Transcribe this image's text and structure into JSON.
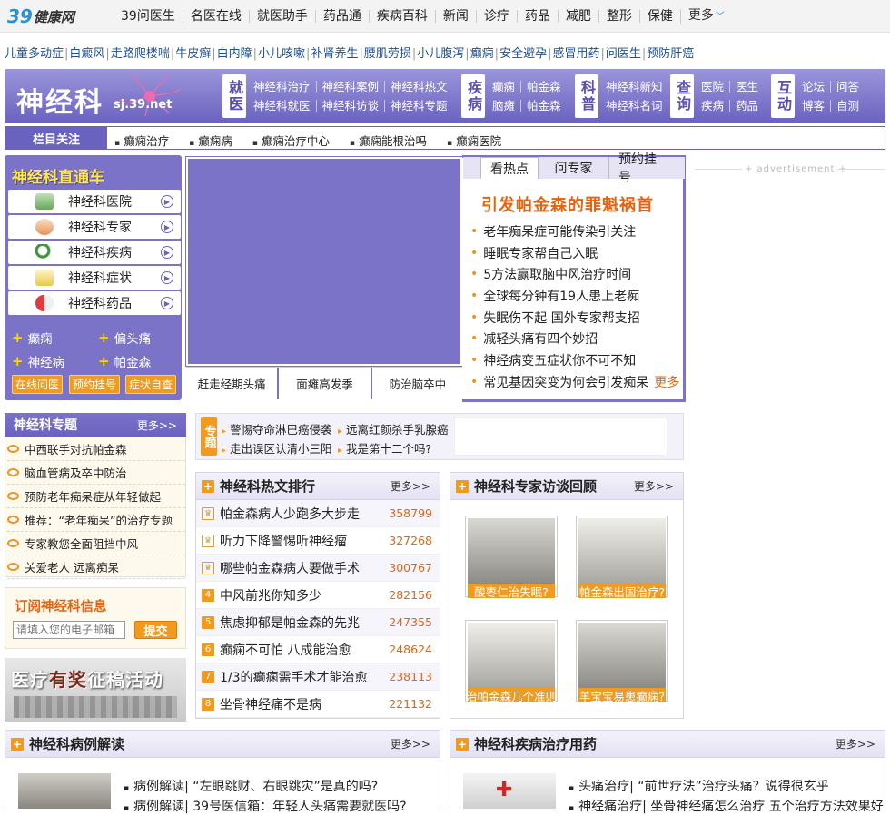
{
  "topbar": {
    "logo_num": "39",
    "logo_brand": "健康网",
    "nav": [
      "39问医生",
      "名医在线",
      "就医助手",
      "药品通",
      "疾病百科",
      "新闻",
      "诊疗",
      "药品",
      "减肥",
      "整形",
      "保健"
    ],
    "more": "更多"
  },
  "sublinks": [
    "儿童多动症",
    "白癜风",
    "走路爬楼喘",
    "牛皮癣",
    "白内障",
    "小儿咳嗽",
    "补肾养生",
    "腰肌劳损",
    "小儿腹泻",
    "癫痫",
    "安全避孕",
    "感冒用药",
    "问医生",
    "预防肝癌"
  ],
  "banner": {
    "title": "神经科",
    "subtitle": "sj.39.net",
    "groups": [
      {
        "tag": "就医",
        "rows": [
          [
            "神经科治疗",
            "神经科案例",
            "神经科热文"
          ],
          [
            "神经科就医",
            "神经科访谈",
            "神经科专题"
          ]
        ]
      },
      {
        "tag": "疾病",
        "rows": [
          [
            "癫痫",
            "帕金森"
          ],
          [
            "脑瘫",
            "帕金森"
          ]
        ]
      },
      {
        "tag": "科普",
        "rows": [
          [
            "神经科新知"
          ],
          [
            "神经科名词"
          ]
        ]
      },
      {
        "tag": "查询",
        "rows": [
          [
            "医院",
            "医生"
          ],
          [
            "疾病",
            "药品"
          ]
        ]
      },
      {
        "tag": "互动",
        "rows": [
          [
            "论坛",
            "问答"
          ],
          [
            "博客",
            "自测"
          ]
        ]
      }
    ]
  },
  "focus": {
    "label": "栏目关注",
    "links": [
      "癫痫治疗",
      "癫痫病",
      "癫痫治疗中心",
      "癫痫能根治吗",
      "癫痫医院"
    ]
  },
  "train": {
    "title": "神经科直通车",
    "items": [
      "神经科医院",
      "神经科专家",
      "神经科疾病",
      "神经科症状",
      "神经科药品"
    ],
    "quick": [
      "癫痫",
      "偏头痛",
      "神经病",
      "帕金森"
    ],
    "buttons": [
      "在线问医",
      "预约挂号",
      "症状自查"
    ]
  },
  "slide": {
    "tabs": [
      "赶走经期头痛",
      "面瘫高发季",
      "防治脑卒中"
    ]
  },
  "hot": {
    "tabs": [
      "看热点",
      "问专家",
      "预约挂号"
    ],
    "headline": "引发帕金森的罪魁祸首",
    "items": [
      "老年痴呆症可能传染引关注",
      "睡眠专家帮自己入眠",
      "5方法赢取脑中风治疗时间",
      "全球每分钟有19人患上老痴",
      "失眠伤不起 国外专家帮支招",
      "减轻头痛有四个妙招",
      "神经病变五症状你不可不知",
      "常见基因突变为何会引发痴呆"
    ],
    "more": "更多"
  },
  "advert": "+ advertisement +",
  "topics": {
    "title": "神经科专题",
    "more": "更多>>",
    "items": [
      "中西联手对抗帕金森",
      "脑血管病及卒中防治",
      "预防老年痴呆症从年轻做起",
      "推荐：“老年痴呆”的治疗专题",
      "专家教您全面阻挡中风",
      "关爱老人 远离痴呆"
    ]
  },
  "subscribe": {
    "title": "订阅神经科信息",
    "placeholder": "请填入您的电子邮箱",
    "button": "提交"
  },
  "ad_banner": {
    "text1": "医疗",
    "text2": "有奖",
    "text3": "征稿活动"
  },
  "strip": {
    "tag": "专题",
    "links": [
      "警惕夺命淋巴癌侵袭",
      "远离红颜杀手乳腺癌",
      "走出误区认清小三阳",
      "我是第十二个吗?"
    ]
  },
  "ranking": {
    "title": "神经科热文排行",
    "more": "更多>>",
    "items": [
      {
        "rank": "1",
        "title": "帕金森病人少跑多大步走",
        "value": "358799"
      },
      {
        "rank": "2",
        "title": "听力下降警惕听神经瘤",
        "value": "327268"
      },
      {
        "rank": "3",
        "title": "哪些帕金森病人要做手术",
        "value": "300767"
      },
      {
        "rank": "4",
        "title": "中风前兆你知多少",
        "value": "282156"
      },
      {
        "rank": "5",
        "title": "焦虑抑郁是帕金森的先兆",
        "value": "247355"
      },
      {
        "rank": "6",
        "title": "癫痫不可怕 八成能治愈",
        "value": "248624"
      },
      {
        "rank": "7",
        "title": "1/3的癫痫需手术才能治愈",
        "value": "238113"
      },
      {
        "rank": "8",
        "title": "坐骨神经痛不是病",
        "value": "221132"
      }
    ]
  },
  "experts": {
    "title": "神经科专家访谈回顾",
    "more": "更多>>",
    "items": [
      "酸枣仁治失眠?",
      "帕金森出国治疗?",
      "治帕金森几个准则",
      "羊宝宝易患癫痫?"
    ]
  },
  "cases": {
    "title": "神经科病例解读",
    "more": "更多>>",
    "items": [
      "病例解读| “左眼跳财、右眼跳灾”是真的吗?",
      "病例解读| 39号医信箱：年轻人头痛需要就医吗?"
    ]
  },
  "treatment": {
    "title": "神经科疾病治疗用药",
    "more": "更多>>",
    "items": [
      "头痛治疗| “前世疗法”治疗头痛？说得很玄乎",
      "神经痛治疗| 坐骨神经痛怎么治疗 五个治疗方法效果好"
    ]
  },
  "colors": {
    "purple": "#7b73c7",
    "orange": "#f19a1e",
    "link_blue": "#1a4f9c"
  }
}
